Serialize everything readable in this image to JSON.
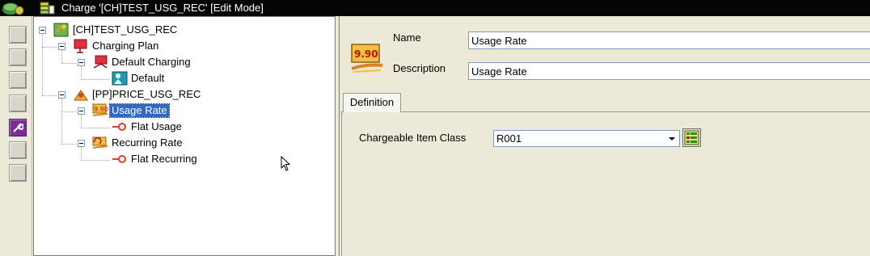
{
  "window": {
    "title": "Charge '[CH]TEST_USG_REC' [Edit Mode]"
  },
  "toolstrip": {
    "tools": [
      {
        "icon": "blank-tool-icon"
      },
      {
        "icon": "blank-tool-icon"
      },
      {
        "icon": "blank-tool-icon"
      },
      {
        "icon": "blank-tool-icon"
      },
      {
        "icon": "wrench-icon",
        "active": true
      },
      {
        "icon": "blank-tool-icon"
      },
      {
        "icon": "blank-tool-icon"
      }
    ]
  },
  "tree": {
    "nodes": [
      {
        "label": "[CH]TEST_USG_REC",
        "icon": "charge-icon",
        "expanded": true
      },
      {
        "label": "Charging Plan",
        "icon": "charging-plan-icon",
        "expanded": true
      },
      {
        "label": "Default Charging",
        "icon": "charging-icon",
        "expanded": true
      },
      {
        "label": "Default",
        "icon": "default-icon"
      },
      {
        "label": "[PP]PRICE_USG_REC",
        "icon": "price-plan-icon",
        "expanded": true
      },
      {
        "label": "Usage Rate",
        "icon": "usage-rate-icon",
        "expanded": true,
        "selected": true
      },
      {
        "label": "Flat Usage",
        "icon": "flat-icon"
      },
      {
        "label": "Recurring  Rate",
        "icon": "recurring-rate-icon",
        "expanded": true
      },
      {
        "label": "Flat Recurring",
        "icon": "flat-icon"
      }
    ]
  },
  "header": {
    "icon_text": "9.90",
    "name_label": "Name",
    "name_value": "Usage Rate",
    "description_label": "Description",
    "description_value": "Usage Rate"
  },
  "tabs": [
    {
      "label": "Definition",
      "active": true
    }
  ],
  "definition": {
    "chargeable_item_class_label": "Chargeable Item Class",
    "chargeable_item_class_value": "R001"
  },
  "colors": {
    "titlebar": "#050505",
    "selection": "#316ac5",
    "panel": "#ece9d8"
  }
}
